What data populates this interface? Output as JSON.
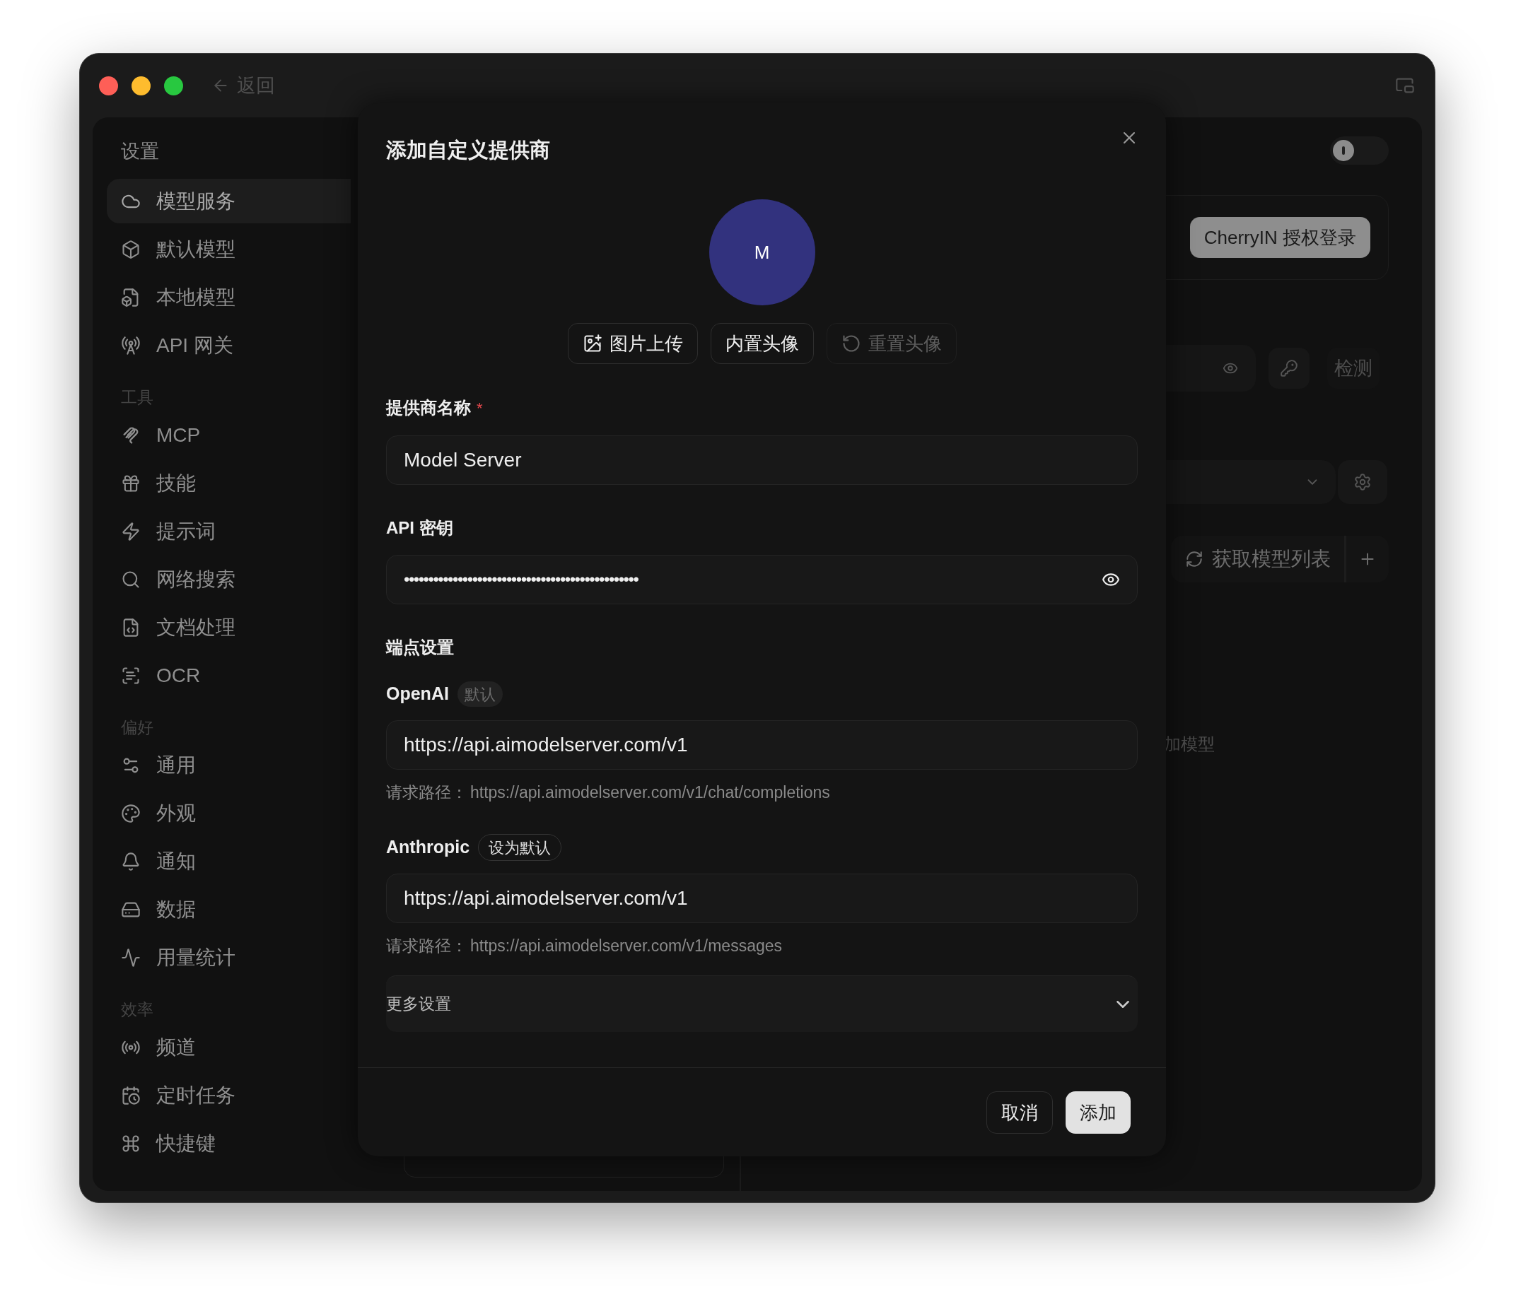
{
  "window": {
    "back_label": "返回"
  },
  "sidebar": {
    "title": "设置",
    "sections": [
      {
        "items": [
          {
            "label": "模型服务",
            "selected": true
          },
          {
            "label": "默认模型",
            "selected": false
          },
          {
            "label": "本地模型",
            "selected": false
          },
          {
            "label": "API 网关",
            "selected": false
          }
        ]
      },
      {
        "header": "工具",
        "items": [
          {
            "label": "MCP",
            "selected": false
          },
          {
            "label": "技能",
            "selected": false
          },
          {
            "label": "提示词",
            "selected": false
          },
          {
            "label": "网络搜索",
            "selected": false
          },
          {
            "label": "文档处理",
            "selected": false
          },
          {
            "label": "OCR",
            "selected": false
          }
        ]
      },
      {
        "header": "偏好",
        "items": [
          {
            "label": "通用",
            "selected": false
          },
          {
            "label": "外观",
            "selected": false
          },
          {
            "label": "通知",
            "selected": false
          },
          {
            "label": "数据",
            "selected": false
          },
          {
            "label": "用量统计",
            "selected": false
          }
        ]
      },
      {
        "header": "效率",
        "items": [
          {
            "label": "频道",
            "selected": false
          },
          {
            "label": "定时任务",
            "selected": false
          },
          {
            "label": "快捷键",
            "selected": false
          }
        ]
      }
    ]
  },
  "background": {
    "toggle": {
      "on": false
    },
    "login_button": "CherryIN 授权登录",
    "check_button": "检测",
    "fetch_models_button": "获取模型列表",
    "add_model_text": "加模型"
  },
  "dialog": {
    "title": "添加自定义提供商",
    "avatar": {
      "letter": "M"
    },
    "avatar_buttons": [
      {
        "kind": "upload",
        "label": "图片上传",
        "disabled": false
      },
      {
        "kind": "builtin",
        "label": "内置头像",
        "disabled": false
      },
      {
        "kind": "reset",
        "label": "重置头像",
        "disabled": true
      }
    ],
    "name_field": {
      "label": "提供商名称",
      "required": true,
      "required_mark": "*",
      "value": "Model Server"
    },
    "api_key_field": {
      "label": "API 密钥",
      "value": "••••••••••••••••••••••••••••••••••••••••••••••••"
    },
    "endpoint_section": "端点设置",
    "endpoints": [
      {
        "name": "OpenAI",
        "badge": {
          "kind": "default",
          "label": "默认"
        },
        "value": "https://api.aimodelserver.com/v1",
        "path_label": "请求路径：",
        "path": "https://api.aimodelserver.com/v1/chat/completions"
      },
      {
        "name": "Anthropic",
        "badge": {
          "kind": "set_default",
          "label": "设为默认"
        },
        "value": "https://api.aimodelserver.com/v1",
        "path_label": "请求路径：",
        "path": "https://api.aimodelserver.com/v1/messages"
      }
    ],
    "more_settings": {
      "label": "更多设置",
      "expanded": false
    },
    "cancel_button": "取消",
    "confirm_button": "添加"
  }
}
